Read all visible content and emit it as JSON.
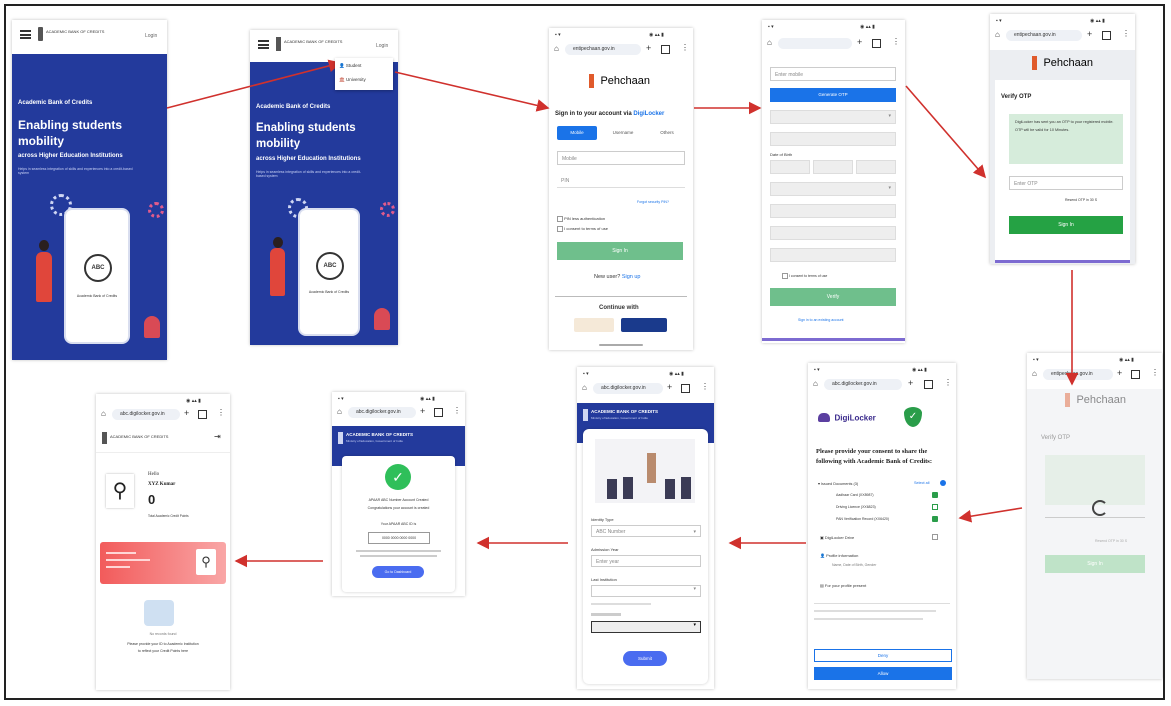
{
  "screens": {
    "s1": {
      "logo_text": "ACADEMIC BANK OF CREDITS",
      "login_label": "Login",
      "heading": "Academic Bank of Credits",
      "title_line1": "Enabling students",
      "title_line2": "mobility",
      "subtitle": "across Higher Education Institutions",
      "description": "Helps in seamless integration of skills and experiences into a credit-based system",
      "abc_label": "ABC",
      "card_label": "Academic Bank of Credits"
    },
    "s2": {
      "logo_text": "ACADEMIC BANK OF CREDITS",
      "login_label": "Login",
      "menu_student": "Student",
      "menu_university": "University",
      "heading": "Academic Bank of Credits",
      "title_line1": "Enabling students",
      "title_line2": "mobility",
      "subtitle": "across Higher Education Institutions",
      "description": "Helps in seamless integration of skills and experiences into a credit-based system",
      "abc_label": "ABC",
      "card_label": "Academic Bank of Credits"
    },
    "s3": {
      "url": "entipechaan.gov.in",
      "brand": "Pehchaan",
      "signin_prefix": "Sign in to your account via ",
      "signin_brand": "DigiLocker",
      "tabs": [
        "Mobile",
        "Username",
        "Others"
      ],
      "mobile_placeholder": "Mobile",
      "pin_placeholder": "PIN",
      "forgot_pin": "Forgot security PIN?",
      "pin_less_auth": "PIN less authentication",
      "consent": "I consent to terms of use",
      "signin_button": "Sign In",
      "new_user": "New user?",
      "signup": "Sign up",
      "continue_with": "Continue with"
    },
    "s4": {
      "mobile_placeholder": "Enter mobile",
      "generate_otp": "Generate OTP",
      "dob_label": "Date of Birth",
      "verify_button": "Verify",
      "signin_link": "Sign in to an existing account",
      "consent": "I consent to terms of use"
    },
    "s5": {
      "url": "entipechaan.gov.in",
      "brand": "Pehchaan",
      "verify_title": "Verify OTP",
      "otp_info": "DigiLocker has sent you an OTP to your registered mobile. OTP will be valid for 10 Minutes.",
      "otp_placeholder": "Enter OTP",
      "resend": "Resend OTP in 30 S",
      "signin_button": "Sign In"
    },
    "s6": {
      "url": "entipechaan.gov.in",
      "brand": "Pehchaan",
      "verify_title": "Verify OTP",
      "resend": "Resend OTP in 30 S",
      "signin_button": "Sign In"
    },
    "s7": {
      "url": "abc.digilocker.gov.in",
      "brand": "DigiLocker",
      "consent_title": "Please provide your consent to share the following with Academic Bank of Credits:",
      "issued_docs": "Issued Documents (3)",
      "select_all": "Select all",
      "docs": [
        "Aadhaar Card (XX8987)",
        "Driving Licence (XX6823)",
        "PAN Verification Record (XX6420)"
      ],
      "digilocker_drive": "DigiLocker Drive",
      "profile_info": "Profile information",
      "profile_detail": "Name, Date of Birth, Gender",
      "purpose": "For your profile present",
      "allow_button": "Allow",
      "deny_button": "Deny"
    },
    "s8": {
      "url": "abc.digilocker.gov.in",
      "header_title": "ACADEMIC BANK OF CREDITS",
      "header_sub": "Ministry of Education, Government of India",
      "identity_label": "Identity Type",
      "identity_value": "ABC Number",
      "admission_label": "Admission Year",
      "admission_placeholder": "Enter year",
      "institution_label": "Last Institution",
      "submit_button": "Submit"
    },
    "s9": {
      "url": "abc.digilocker.gov.in",
      "header_title": "ACADEMIC BANK OF CREDITS",
      "header_sub": "Ministry of Education, Government of India",
      "success_line1": "APAAR ABC Number Account Created",
      "success_line2": "Congratulations your account is created",
      "id_label": "Your APAAR ABC ID is",
      "id_value": "0000 0000 0000 0000",
      "go_dashboard": "Go to Dashboard"
    },
    "s10": {
      "url": "abc.digilocker.gov.in",
      "header_title": "ACADEMIC BANK OF CREDITS",
      "greeting": "Hello",
      "name": "XYZ Kumar",
      "credits": "0",
      "credits_label": "Total Academic Credit Points",
      "no_records": "No records found",
      "info_line1": "Please provide your ID to Academic Institution",
      "info_line2": "to reflect your Credit Points here"
    }
  }
}
